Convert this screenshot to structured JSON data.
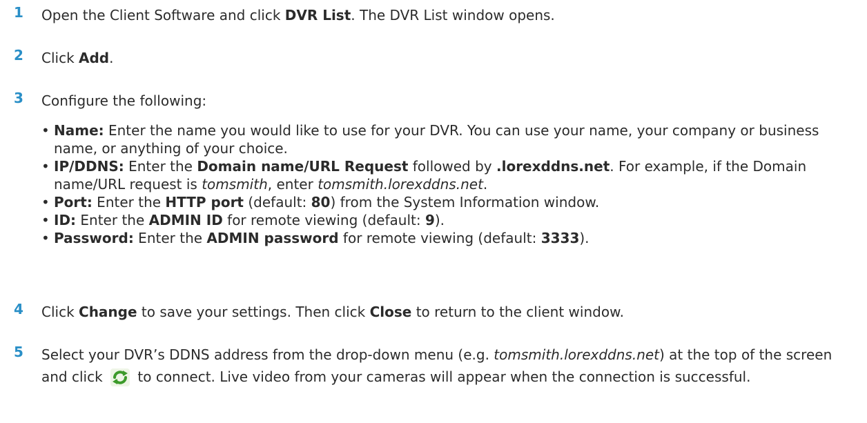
{
  "steps": [
    {
      "number": "1",
      "parts": [
        {
          "t": "Open the Client Software and click "
        },
        {
          "t": "DVR List",
          "b": true
        },
        {
          "t": ". The DVR List window opens."
        }
      ]
    },
    {
      "number": "2",
      "parts": [
        {
          "t": "Click "
        },
        {
          "t": "Add",
          "b": true
        },
        {
          "t": "."
        }
      ]
    },
    {
      "number": "3",
      "parts": [
        {
          "t": "Configure the following:"
        }
      ]
    },
    {
      "number": "4",
      "parts": [
        {
          "t": "Click "
        },
        {
          "t": "Change",
          "b": true
        },
        {
          "t": " to save your settings. Then click "
        },
        {
          "t": "Close",
          "b": true
        },
        {
          "t": " to return to the client window."
        }
      ]
    },
    {
      "number": "5",
      "parts": [
        {
          "t": "Select your DVR’s DDNS address from the drop-down menu (e.g. "
        },
        {
          "t": "tomsmith.lorexddns.net",
          "i": true
        },
        {
          "t": ") at the top of the screen and click "
        },
        {
          "icon": "refresh-icon"
        },
        {
          "t": " to connect. Live video from your cameras will appear when the connection is successful."
        }
      ]
    }
  ],
  "config_bullets": [
    [
      {
        "t": "Name:",
        "b": true
      },
      {
        "t": " Enter the name you would like to use for your DVR. You can use your name, your company or business name, or anything of your choice."
      }
    ],
    [
      {
        "t": "IP/DDNS:",
        "b": true
      },
      {
        "t": " Enter the "
      },
      {
        "t": "Domain name/URL Request",
        "b": true
      },
      {
        "t": " followed by "
      },
      {
        "t": ".lorexddns.net",
        "b": true
      },
      {
        "t": ". For example, if the Domain name/URL request is "
      },
      {
        "t": "tomsmith",
        "i": true
      },
      {
        "t": ", enter "
      },
      {
        "t": "tomsmith.lorexddns.net",
        "i": true
      },
      {
        "t": "."
      }
    ],
    [
      {
        "t": "Port:",
        "b": true
      },
      {
        "t": " Enter the "
      },
      {
        "t": "HTTP port",
        "b": true
      },
      {
        "t": " (default: "
      },
      {
        "t": "80",
        "b": true
      },
      {
        "t": ") from the System Information window."
      }
    ],
    [
      {
        "t": "ID:",
        "b": true
      },
      {
        "t": " Enter the "
      },
      {
        "t": "ADMIN ID",
        "b": true
      },
      {
        "t": " for remote viewing (default: "
      },
      {
        "t": "9",
        "b": true
      },
      {
        "t": ")."
      }
    ],
    [
      {
        "t": "Password:",
        "b": true
      },
      {
        "t": " Enter the "
      },
      {
        "t": "ADMIN password",
        "b": true
      },
      {
        "t": " for remote viewing (default: "
      },
      {
        "t": "3333",
        "b": true
      },
      {
        "t": ")."
      }
    ]
  ],
  "colors": {
    "step_number": "#2a8fc7",
    "body_text": "#2b2b2b"
  },
  "icons": {
    "refresh": "refresh-icon"
  }
}
